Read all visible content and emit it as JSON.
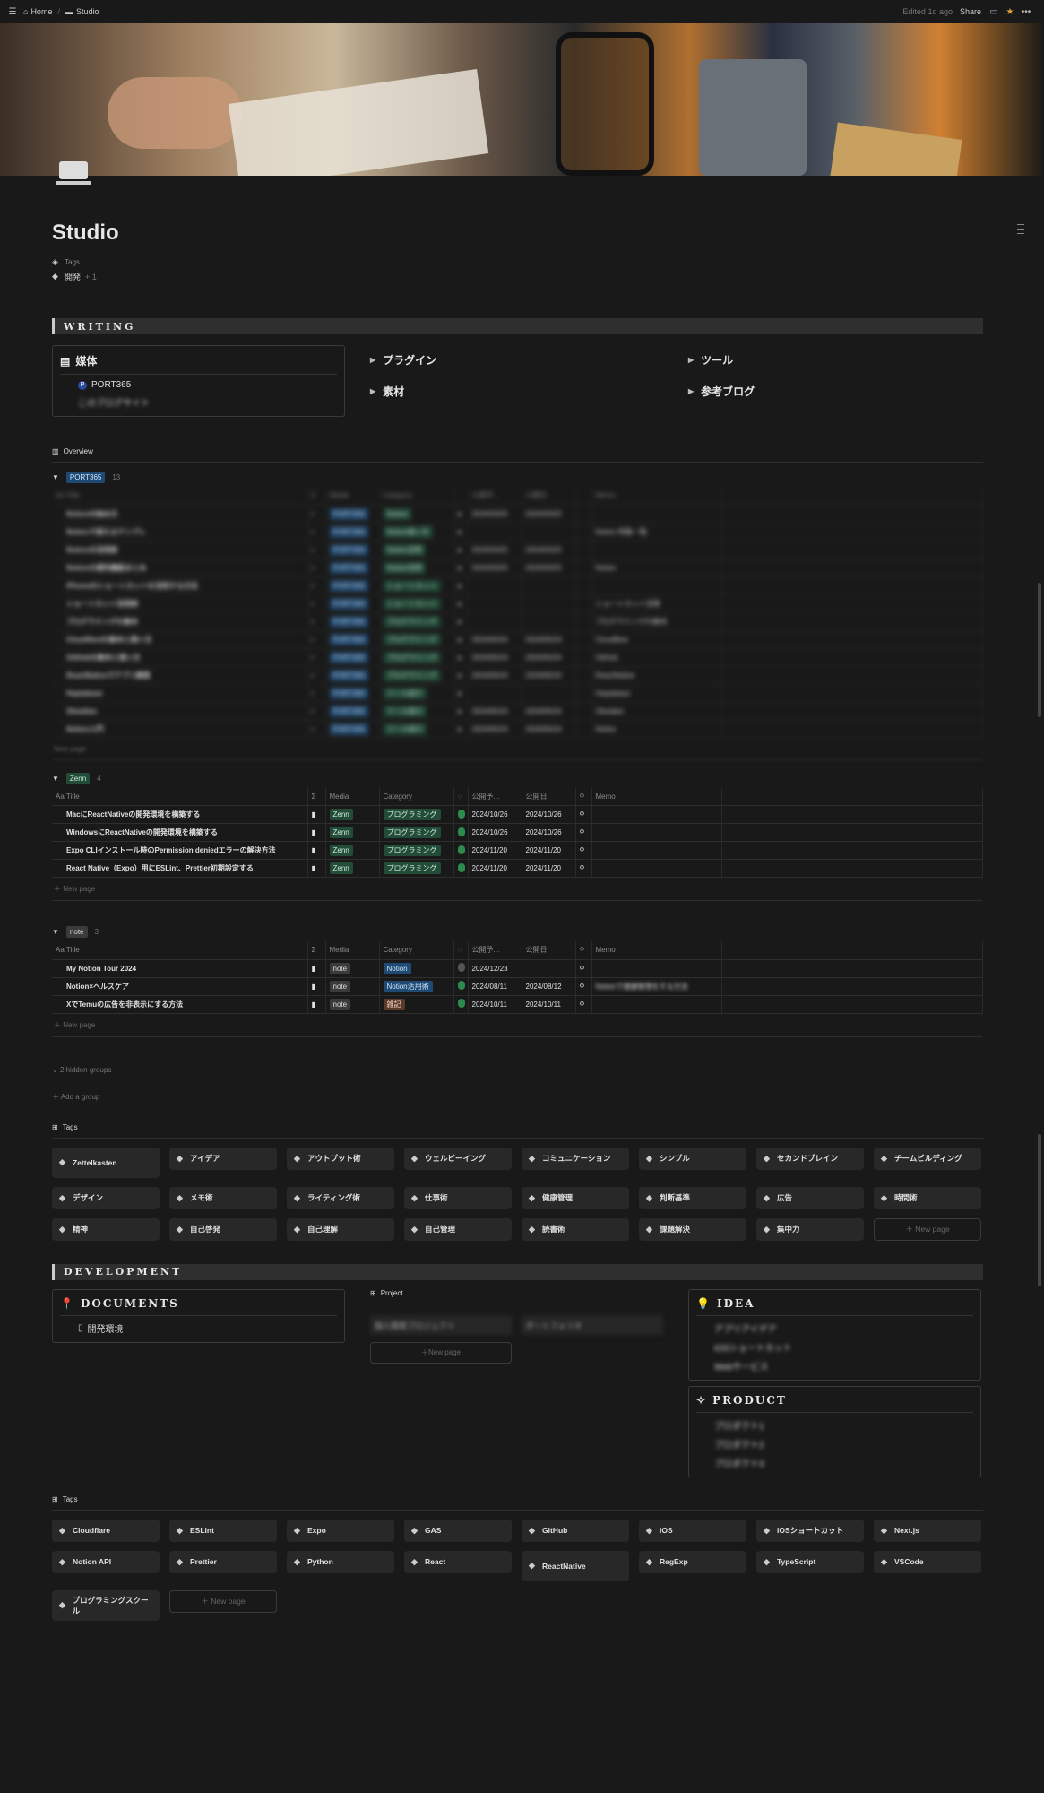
{
  "topbar": {
    "home": "Home",
    "page": "Studio",
    "edited": "Edited 1d ago",
    "share": "Share"
  },
  "page": {
    "title": "Studio",
    "prop_label": "Tags",
    "prop_value": "開発",
    "prop_more": "+ 1"
  },
  "writing": {
    "heading": "WRITING",
    "media_title": "媒体",
    "media_items": [
      "PORT365",
      "このブログサイト"
    ],
    "toggles_mid": [
      "プラグイン",
      "素材"
    ],
    "toggles_right": [
      "ツール",
      "参考ブログ"
    ]
  },
  "view": {
    "tab": "Overview"
  },
  "columns": [
    "Aa Title",
    "Σ",
    "Media",
    "Category",
    "",
    "公開予...",
    "公開日",
    "",
    "Memo"
  ],
  "port365": {
    "label": "PORT365",
    "count": "13",
    "rows": [
      [
        "Notionの始め方",
        "PORT365",
        "Notion",
        "2024/03/25",
        "2024/03/25",
        ""
      ],
      [
        "Notionで使えるテンプレ",
        "PORT365",
        "Notion使い方",
        "",
        "",
        "Notion 特集一覧"
      ],
      [
        "Notionの活用術",
        "PORT365",
        "Notion活用",
        "2024/03/25",
        "2024/03/25",
        ""
      ],
      [
        "Notionの便利機能まとめ",
        "PORT365",
        "Notion活用",
        "2024/03/25",
        "2024/03/25",
        "Notion"
      ],
      [
        "iPhoneのショートカットを活用する方法",
        "PORT365",
        "ショートカット",
        "",
        "",
        ""
      ],
      [
        "ショートカット活用術",
        "PORT365",
        "ショートカット",
        "",
        "",
        "ショートカット活用"
      ],
      [
        "プログラミングの基本",
        "PORT365",
        "プログラミング",
        "",
        "",
        "プログラミングの基本"
      ],
      [
        "Cloudflareの基本と使い方",
        "PORT365",
        "プログラミング",
        "2024/05/24",
        "2024/05/24",
        "Cloudflare"
      ],
      [
        "GitHubの基本と使い方",
        "PORT365",
        "プログラミング",
        "2024/05/24",
        "2024/05/24",
        "GitHub"
      ],
      [
        "ReactNativeでアプリ開発",
        "PORT365",
        "プログラミング",
        "2024/05/24",
        "2024/05/24",
        "ReactNative"
      ],
      [
        "Heptabase",
        "PORT365",
        "ツール紹介",
        "",
        "",
        "Heptabase"
      ],
      [
        "Obsidian",
        "PORT365",
        "ツール紹介",
        "2024/05/24",
        "2024/05/24",
        "Obsidian"
      ],
      [
        "Notion入門",
        "PORT365",
        "ツール紹介",
        "2024/05/24",
        "2024/05/24",
        "Notion"
      ]
    ]
  },
  "zenn": {
    "label": "Zenn",
    "count": "4",
    "rows": [
      {
        "title": "MacにReactNativeの開発環境を構築する",
        "media": "Zenn",
        "cat": "プログラミング",
        "p1": "2024/10/26",
        "p2": "2024/10/26"
      },
      {
        "title": "WindowsにReactNativeの開発環境を構築する",
        "media": "Zenn",
        "cat": "プログラミング",
        "p1": "2024/10/26",
        "p2": "2024/10/26"
      },
      {
        "title": "Expo CLIインストール時のPermission deniedエラーの解決方法",
        "media": "Zenn",
        "cat": "プログラミング",
        "p1": "2024/11/20",
        "p2": "2024/11/20"
      },
      {
        "title": "React Native（Expo）用にESLint、Prettier初期設定する",
        "media": "Zenn",
        "cat": "プログラミング",
        "p1": "2024/11/20",
        "p2": "2024/11/20"
      }
    ]
  },
  "note": {
    "label": "note",
    "count": "3",
    "rows": [
      {
        "title": "My Notion Tour 2024",
        "media": "note",
        "cat": "Notion",
        "p1": "2024/12/23",
        "p2": "",
        "memo": ""
      },
      {
        "title": "Notion×ヘルスケア",
        "media": "note",
        "cat": "Notion活用術",
        "p1": "2024/08/11",
        "p2": "2024/08/12",
        "memo": "Notionで健康管理をする方法"
      },
      {
        "title": "XでTemuの広告を非表示にする方法",
        "media": "note",
        "cat": "雑記",
        "p1": "2024/10/11",
        "p2": "2024/10/11",
        "memo": ""
      }
    ]
  },
  "new_page": "New page",
  "hidden_groups": "2 hidden groups",
  "add_group": "Add a group",
  "tags_title": "Tags",
  "tags1": [
    "Zettelkasten",
    "アイデア",
    "アウトプット術",
    "ウェルビーイング",
    "コミュニケーション",
    "シンプル",
    "セカンドブレイン",
    "チームビルディング",
    "デザイン",
    "メモ術",
    "ライティング術",
    "仕事術",
    "健康管理",
    "判断基準",
    "広告",
    "時間術",
    "精神",
    "自己啓発",
    "自己理解",
    "自己管理",
    "読書術",
    "課題解決",
    "集中力"
  ],
  "development": {
    "heading": "DEVELOPMENT",
    "documents": "DOCUMENTS",
    "doc_item": "開発環境",
    "project": "Project",
    "project_items": [
      "個人開発プロジェクト",
      "ポートフォリオ"
    ],
    "idea": "IDEA",
    "idea_items": [
      "アプリアイデア",
      "iOSショートカット",
      "Webサービス"
    ],
    "product": "PRODUCT",
    "product_items": [
      "プロダクト1",
      "プロダクト2",
      "プロダクト3"
    ]
  },
  "tags2": [
    "Cloudflare",
    "ESLint",
    "Expo",
    "GAS",
    "GitHub",
    "iOS",
    "iOSショートカット",
    "Next.js",
    "Notion API",
    "Prettier",
    "Python",
    "React",
    "ReactNative",
    "RegExp",
    "TypeScript",
    "VSCode",
    "プログラミングスクール"
  ]
}
